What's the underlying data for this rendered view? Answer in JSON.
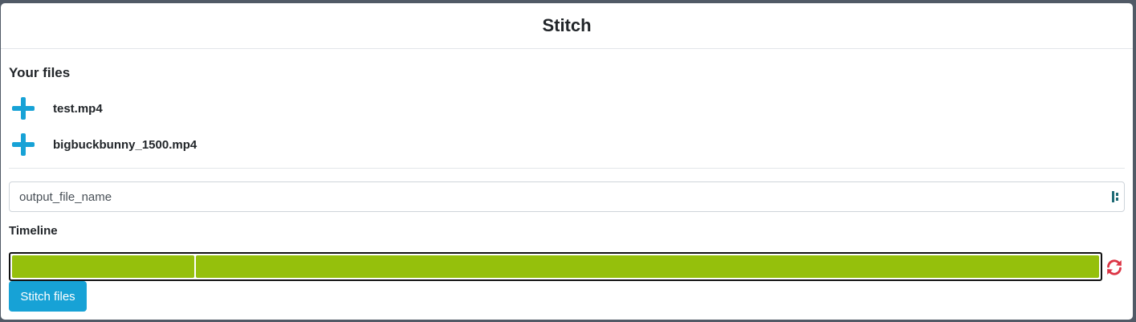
{
  "header": {
    "title": "Stitch"
  },
  "files": {
    "section_title": "Your files",
    "items": [
      {
        "name": "test.mp4",
        "icon": "plus-icon"
      },
      {
        "name": "bigbuckbunny_1500.mp4",
        "icon": "plus-icon"
      }
    ]
  },
  "output": {
    "placeholder": "output_file_name",
    "value": ""
  },
  "timeline": {
    "label": "Timeline",
    "segments": [
      {
        "id": "segment-1",
        "share": 0.168
      },
      {
        "id": "segment-2",
        "share": 0.832
      }
    ]
  },
  "actions": {
    "stitch_label": "Stitch files",
    "refresh_icon": "refresh-icon"
  },
  "colors": {
    "accent": "#17a2d6",
    "segment": "#95c00c",
    "refresh": "#dc3545",
    "backdrop": "#515a66"
  }
}
